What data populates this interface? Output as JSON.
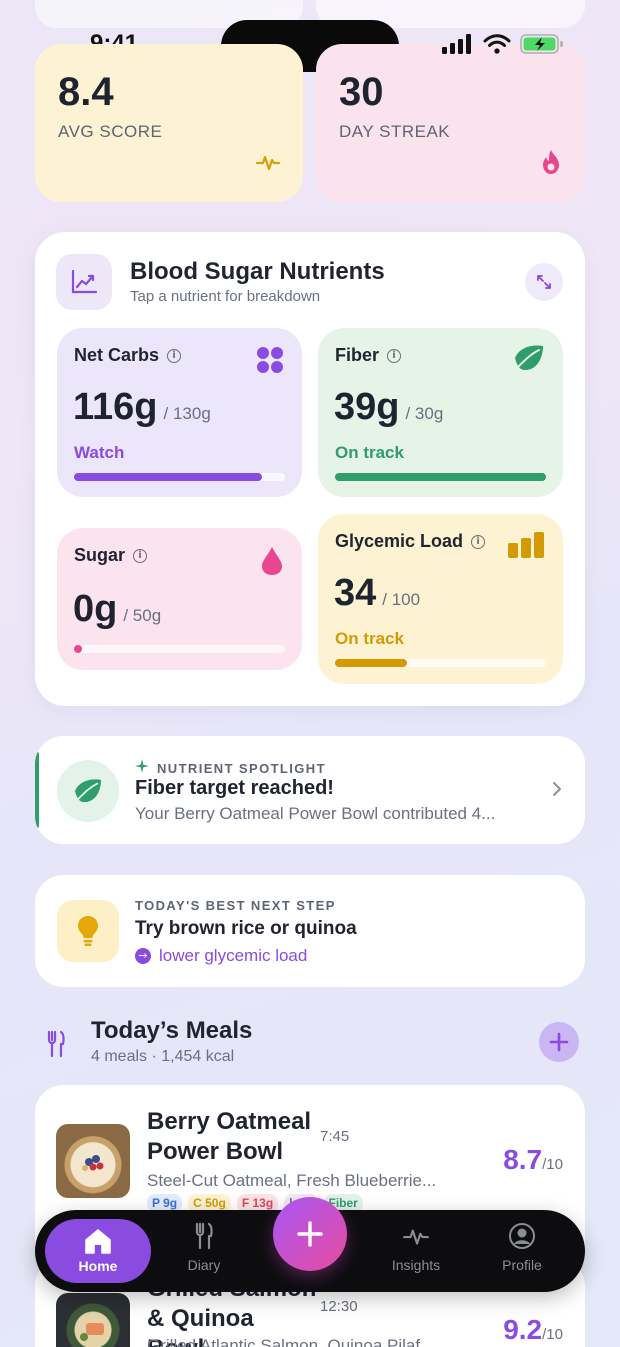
{
  "status_bar": {
    "time": "9:41"
  },
  "stats": [
    {
      "value": "8.4",
      "label": "AVG SCORE",
      "icon": "pulse-icon",
      "bg": "#fdf3d4",
      "icon_color": "#d4a106"
    },
    {
      "value": "30",
      "label": "DAY STREAK",
      "icon": "flame-icon",
      "bg": "#fbe3ee",
      "icon_color": "#e8468f"
    }
  ],
  "nutrients_panel": {
    "title": "Blood Sugar Nutrients",
    "subtitle": "Tap a nutrient for breakdown",
    "cards": [
      {
        "name": "Net Carbs",
        "value": "116g",
        "target": "/ 130g",
        "status": "Watch",
        "status_color": "#8a4be0",
        "progress": 0.89,
        "bar_color": "#8a4be0",
        "bg": "#ece6fa",
        "icon": "dots-grid-icon"
      },
      {
        "name": "Fiber",
        "value": "39g",
        "target": "/ 30g",
        "status": "On track",
        "status_color": "#2f9e6b",
        "progress": 1.0,
        "bar_color": "#2f9e6b",
        "bg": "#e5f4e6",
        "icon": "leaf-icon"
      },
      {
        "name": "Sugar",
        "value": "0g",
        "target": "/ 50g",
        "status": "",
        "progress": 0.0,
        "bar_color": "#e8468f",
        "bg": "#fbe4ee",
        "icon": "drop-icon"
      },
      {
        "name": "Glycemic Load",
        "value": "34",
        "target": "/ 100",
        "status": "On track",
        "status_color": "#d49a06",
        "progress": 0.34,
        "bar_color": "#d49a06",
        "bg": "#fdf2d2",
        "icon": "bar-chart-icon"
      }
    ]
  },
  "spotlight": {
    "eyebrow": "NUTRIENT SPOTLIGHT",
    "title": "Fiber target reached!",
    "body": "Your Berry Oatmeal Power Bowl contributed 4..."
  },
  "next_step": {
    "eyebrow": "TODAY'S BEST NEXT STEP",
    "title": "Try brown rice or quinoa",
    "link": "lower glycemic load"
  },
  "meals": {
    "title": "Today’s Meals",
    "subtitle": "4 meals · 1,454 kcal",
    "items": [
      {
        "name": "Berry Oatmeal Power Bowl",
        "time": "7:45",
        "desc": "Steel-Cut Oatmeal, Fresh Blueberrie...",
        "score": "8.7",
        "score_suffix": "/10",
        "tags": [
          {
            "label": "P 9g",
            "color": "#3b6fd6",
            "bg": "#e3ecfb"
          },
          {
            "label": "C 50g",
            "color": "#d49a06",
            "bg": "#fdf2d2"
          },
          {
            "label": "F 13g",
            "color": "#e0465b",
            "bg": "#fbe3e6"
          },
          {
            "label": "kcal",
            "color": "#6a7080",
            "bg": "#eeeef2"
          },
          {
            "label": "Fiber",
            "color": "#2f9e6b",
            "bg": "#e3f3ea"
          }
        ]
      },
      {
        "name": "Grilled Salmon & Quinoa Bowl",
        "time": "12:30",
        "desc": "Grilled Atlantic Salmon, Quinoa Pilaf...",
        "score": "9.2",
        "score_suffix": "/10"
      }
    ]
  },
  "nav": {
    "items": [
      {
        "label": "Home",
        "icon": "home-icon",
        "active": true
      },
      {
        "label": "Diary",
        "icon": "fork-knife-icon"
      },
      {
        "label": "Insights",
        "icon": "pulse-icon"
      },
      {
        "label": "Profile",
        "icon": "profile-icon"
      }
    ],
    "fab_icon": "plus-icon"
  }
}
